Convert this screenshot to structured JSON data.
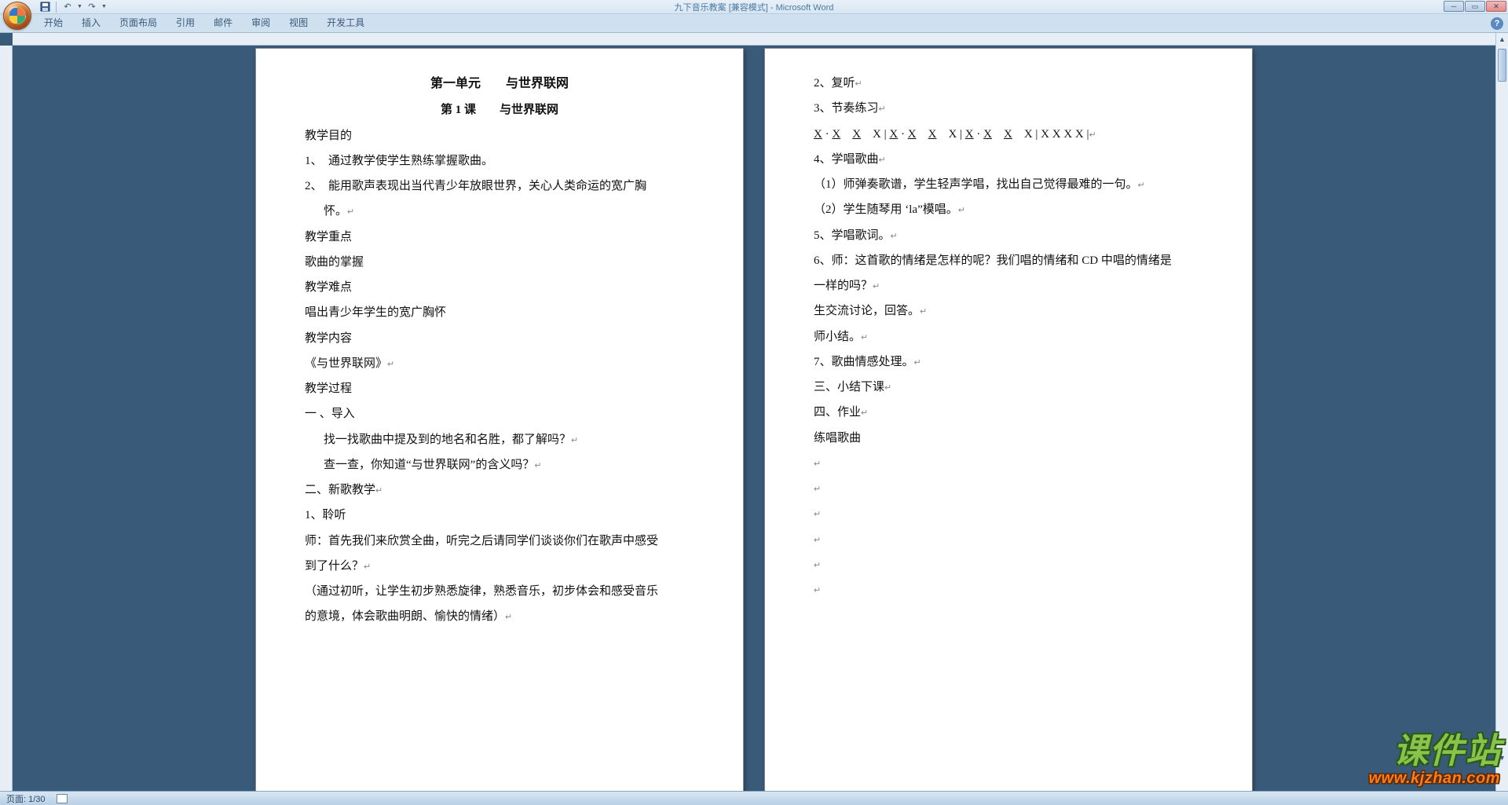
{
  "window": {
    "title": "九下音乐教案 [兼容模式] - Microsoft Word"
  },
  "ribbon": {
    "tabs": [
      "开始",
      "插入",
      "页面布局",
      "引用",
      "邮件",
      "审阅",
      "视图",
      "开发工具"
    ]
  },
  "doc": {
    "page1": {
      "unit_title": "第一单元　　与世界联网",
      "lesson_title": "第 1 课　　与世界联网",
      "p_goal_label": "教学目的",
      "p_goal_1": "1、　通过教学使学生熟练掌握歌曲。",
      "p_goal_2a": "2、　能用歌声表现出当代青少年放眼世界，关心人类命运的宽广胸",
      "p_goal_2b": "怀。",
      "p_keypoint_label": "教学重点",
      "p_keypoint": "歌曲的掌握",
      "p_hardpoint_label": "教学难点",
      "p_hardpoint": "唱出青少年学生的宽广胸怀",
      "p_content_label": "教学内容",
      "p_content": "《与世界联网》",
      "p_process_label": "教学过程",
      "p_intro_label": "一 、导入",
      "p_intro_1": "找一找歌曲中提及到的地名和名胜，都了解吗？",
      "p_intro_2": "查一查，你知道“与世界联网”的含义吗？",
      "p_newsong_label": "二、新歌教学",
      "p_listen_label": "1、聆听",
      "p_listen_1a": "师：首先我们来欣赏全曲，听完之后请同学们谈谈你们在歌声中感受",
      "p_listen_1b": "到了什么？",
      "p_listen_2a": "（通过初听，让学生初步熟悉旋律，熟悉音乐，初步体会和感受音乐",
      "p_listen_2b": "的意境，体会歌曲明朗、愉快的情绪）"
    },
    "page2": {
      "p_replay": "2、复听",
      "p_rhythm_label": "3、节奏练习",
      "p_rhythm_pattern_plain": "X · X　X　X | X · X　X　X | X · X　X　X | X X X X |",
      "p_sing_melody_label": "4、学唱歌曲",
      "p_sing_1": "（1）师弹奏歌谱，学生轻声学唱，找出自己觉得最难的一句。",
      "p_sing_2": "（2）学生随琴用 ‘la”模唱。",
      "p_sing_lyrics": "5、学唱歌词。",
      "p_q_a": "6、师：这首歌的情绪是怎样的呢？我们唱的情绪和 CD 中唱的情绪是",
      "p_q_b": "一样的吗？",
      "p_discuss": "生交流讨论，回答。",
      "p_summary": "师小结。",
      "p_emotion": "7、歌曲情感处理。",
      "p_end": "三、小结下课",
      "p_homework_label": "四、作业",
      "p_homework": "练唱歌曲"
    }
  },
  "status": {
    "page": "页面: 1/30"
  },
  "watermark": {
    "chars": [
      "课",
      "件",
      "站"
    ],
    "url": "www.kjzhan.com"
  }
}
